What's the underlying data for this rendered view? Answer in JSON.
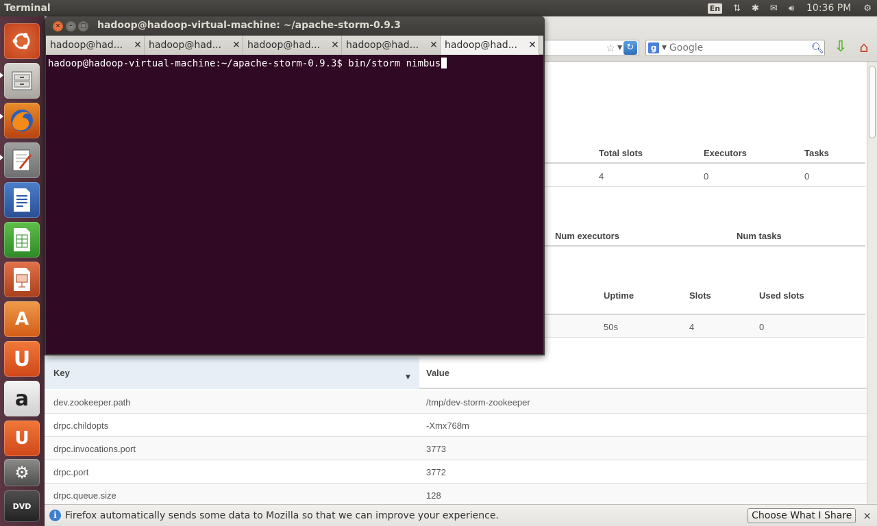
{
  "top_panel": {
    "app_title": "Terminal",
    "lang": "En",
    "clock": "10:36 PM",
    "icons": [
      "network-icon",
      "bluetooth-icon",
      "mail-icon",
      "volume-icon",
      "settings-gear-icon"
    ]
  },
  "launcher": {
    "items": [
      {
        "name": "ubuntu-dash-icon",
        "glyph": "◎"
      },
      {
        "name": "files-icon",
        "glyph": "▤"
      },
      {
        "name": "firefox-icon",
        "glyph": "●"
      },
      {
        "name": "text-editor-icon",
        "glyph": "✎"
      },
      {
        "name": "libreoffice-writer-icon",
        "glyph": "≡"
      },
      {
        "name": "libreoffice-calc-icon",
        "glyph": "▦"
      },
      {
        "name": "libreoffice-impress-icon",
        "glyph": "▨"
      },
      {
        "name": "software-center-icon",
        "glyph": "A"
      },
      {
        "name": "ubuntu-one-icon",
        "glyph": "U"
      },
      {
        "name": "amazon-icon",
        "glyph": "a"
      },
      {
        "name": "ubuntu-one-music-icon",
        "glyph": "U"
      },
      {
        "name": "system-settings-icon",
        "glyph": "⚙"
      },
      {
        "name": "dvd-icon",
        "glyph": "DVD"
      }
    ]
  },
  "terminal": {
    "title": "hadoop@hadoop-virtual-machine: ~/apache-storm-0.9.3",
    "tabs": [
      {
        "label": "hadoop@had..."
      },
      {
        "label": "hadoop@had..."
      },
      {
        "label": "hadoop@had..."
      },
      {
        "label": "hadoop@had..."
      },
      {
        "label": "hadoop@had..."
      }
    ],
    "prompt": "hadoop@hadoop-virtual-machine:~/apache-storm-0.9.3$ ",
    "command": "bin/storm nimbus"
  },
  "browser": {
    "search_placeholder": "Google",
    "cluster_summary": {
      "headers": [
        "Total slots",
        "Executors",
        "Tasks"
      ],
      "row": [
        "4",
        "0",
        "0"
      ]
    },
    "topology_summary": {
      "headers": [
        "Num executors",
        "Num tasks"
      ]
    },
    "supervisor_summary": {
      "headers": [
        "Uptime",
        "Slots",
        "Used slots"
      ],
      "row": [
        "50s",
        "4",
        "0"
      ]
    },
    "config": {
      "key_header": "Key",
      "value_header": "Value",
      "rows": [
        {
          "key": "dev.zookeeper.path",
          "value": "/tmp/dev-storm-zookeeper"
        },
        {
          "key": "drpc.childopts",
          "value": "-Xmx768m"
        },
        {
          "key": "drpc.invocations.port",
          "value": "3773"
        },
        {
          "key": "drpc.port",
          "value": "3772"
        },
        {
          "key": "drpc.queue.size",
          "value": "128"
        }
      ]
    },
    "notification": {
      "message": "Firefox automatically sends some data to Mozilla so that we can improve your experience.",
      "button": "Choose What I Share",
      "close": "×"
    }
  }
}
